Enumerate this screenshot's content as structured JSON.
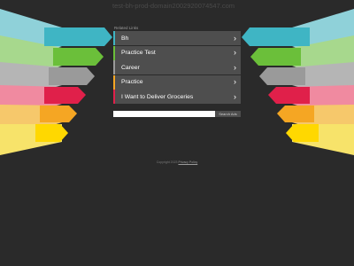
{
  "domain": "test-bh-prod-domain2002920074547.com",
  "related_label": "Related Links",
  "links": [
    {
      "label": "Bh",
      "color": "#3fb5c4"
    },
    {
      "label": "Practice Test",
      "color": "#6bbf3a"
    },
    {
      "label": "Career",
      "color": "#9a9a9a"
    },
    {
      "label": "Practice",
      "color": "#f5a623"
    },
    {
      "label": "I Want to Deliver Groceries",
      "color": "#e0204a"
    }
  ],
  "search": {
    "value": "",
    "button_label": "Search Ads"
  },
  "footer": {
    "copyright": "Copyright 2023 ",
    "privacy_label": "Privacy Policy"
  },
  "colors": {
    "background": "#2a2a2a",
    "panel": "#4e4e4e"
  }
}
